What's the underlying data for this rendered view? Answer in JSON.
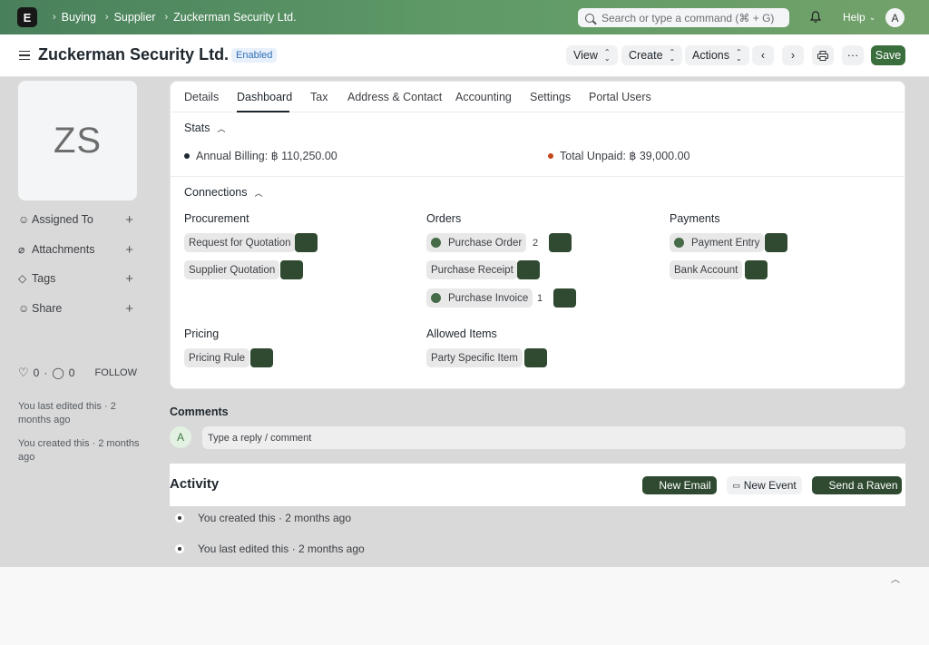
{
  "navbar": {
    "logo_letter": "E",
    "breadcrumbs": [
      "Buying",
      "Supplier",
      "Zuckerman Security Ltd."
    ],
    "search_placeholder": "Search or type a command (⌘ + G)",
    "help_label": "Help",
    "user_initial": "A"
  },
  "header": {
    "title": "Zuckerman Security Ltd.",
    "status": "Enabled",
    "view_label": "View",
    "create_label": "Create",
    "actions_label": "Actions",
    "save_label": "Save"
  },
  "sidebar": {
    "image_initials": "ZS",
    "items": [
      {
        "label": "Assigned To",
        "icon": "user-icon"
      },
      {
        "label": "Attachments",
        "icon": "paperclip-icon"
      },
      {
        "label": "Tags",
        "icon": "tag-icon"
      },
      {
        "label": "Share",
        "icon": "share-icon"
      }
    ],
    "likes_count": "0",
    "comments_count": "0",
    "follow_label": "FOLLOW",
    "last_edited": "You last edited this · 2 months ago",
    "created": "You created this · 2 months ago"
  },
  "tabs": [
    "Details",
    "Dashboard",
    "Tax",
    "Address & Contact",
    "Accounting",
    "Settings",
    "Portal Users"
  ],
  "stats": {
    "title": "Stats",
    "annual_billing": "Annual Billing: ฿ 110,250.00",
    "total_unpaid": "Total Unpaid: ฿ 39,000.00",
    "billing_dot_color": "#1f272e",
    "unpaid_dot_color": "#c4461b"
  },
  "connections": {
    "title": "Connections",
    "procurement": {
      "title": "Procurement",
      "items": [
        "Request for Quotation",
        "Supplier Quotation"
      ]
    },
    "orders": {
      "title": "Orders",
      "items": [
        "Purchase Order",
        "Purchase Receipt",
        "Purchase Invoice"
      ],
      "counts": [
        "2",
        "1"
      ]
    },
    "payments": {
      "title": "Payments",
      "items": [
        "Payment Entry",
        "Bank Account"
      ]
    },
    "pricing": {
      "title": "Pricing",
      "items": [
        "Pricing Rule"
      ]
    },
    "allowed_items": {
      "title": "Allowed Items",
      "items": [
        "Party Specific Item"
      ]
    }
  },
  "comments": {
    "title": "Comments",
    "avatar_initial": "A",
    "placeholder": "Type a reply / comment"
  },
  "activity": {
    "title": "Activity",
    "new_email": "New Email",
    "new_event": "New Event",
    "send_raven": "Send a Raven",
    "timeline": [
      "You created this · 2 months ago",
      "You last edited this · 2 months ago"
    ]
  },
  "colors": {
    "navbar_start": "#49805c",
    "accent": "#3b6e3d"
  }
}
